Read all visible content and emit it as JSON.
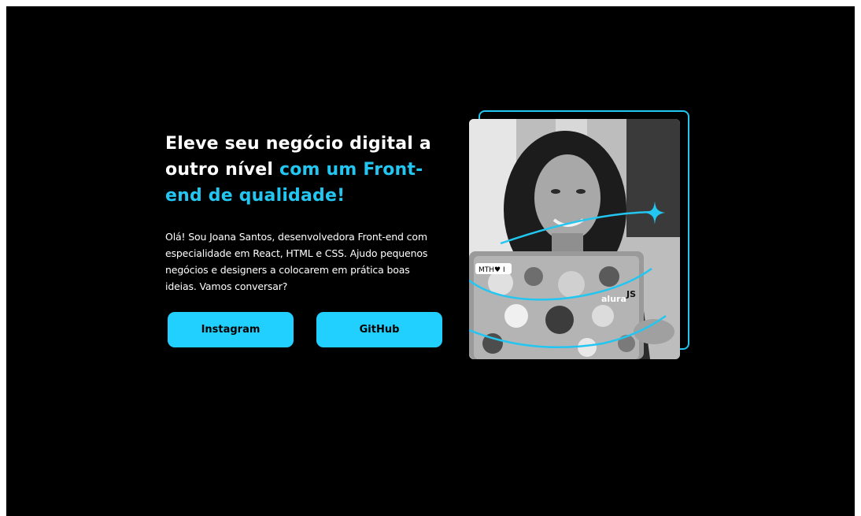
{
  "hero": {
    "headline_white": "Eleve seu negócio digital a outro nível",
    "headline_accent": "com um Front-end de qualidade!",
    "description": "Olá! Sou Joana Santos, desenvolvedora Front-end com especialidade em React, HTML e CSS. Ajudo pequenos negócios e designers a colocarem em prática boas ideias. Vamos conversar?"
  },
  "buttons": {
    "instagram_label": "Instagram",
    "github_label": "GitHub"
  },
  "photo": {
    "sticker_text_1": "MTH♥ I",
    "sticker_text_2": "alura",
    "sticker_text_3": "JS"
  },
  "colors": {
    "background": "#000000",
    "accent": "#22c6f0",
    "button": "#22d0ff"
  },
  "icons": {
    "sparkle": "four-point-star-icon"
  }
}
